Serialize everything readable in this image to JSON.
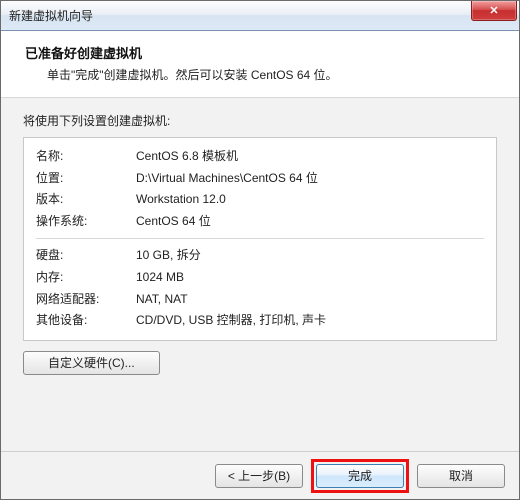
{
  "window": {
    "title": "新建虚拟机向导",
    "close_glyph": "✕"
  },
  "header": {
    "title": "已准备好创建虚拟机",
    "subtitle": "单击\"完成\"创建虚拟机。然后可以安装 CentOS 64 位。"
  },
  "body": {
    "intro": "将使用下列设置创建虚拟机:",
    "rows_top": [
      {
        "label": "名称:",
        "value": "CentOS 6.8 模板机"
      },
      {
        "label": "位置:",
        "value": "D:\\Virtual Machines\\CentOS 64 位"
      },
      {
        "label": "版本:",
        "value": "Workstation 12.0"
      },
      {
        "label": "操作系统:",
        "value": "CentOS 64 位"
      }
    ],
    "rows_bottom": [
      {
        "label": "硬盘:",
        "value": "10 GB, 拆分"
      },
      {
        "label": "内存:",
        "value": "1024 MB"
      },
      {
        "label": "网络适配器:",
        "value": "NAT, NAT"
      },
      {
        "label": "其他设备:",
        "value": "CD/DVD, USB 控制器, 打印机, 声卡"
      }
    ],
    "customize_label": "自定义硬件(C)..."
  },
  "footer": {
    "back_label": "< 上一步(B)",
    "finish_label": "完成",
    "cancel_label": "取消"
  }
}
